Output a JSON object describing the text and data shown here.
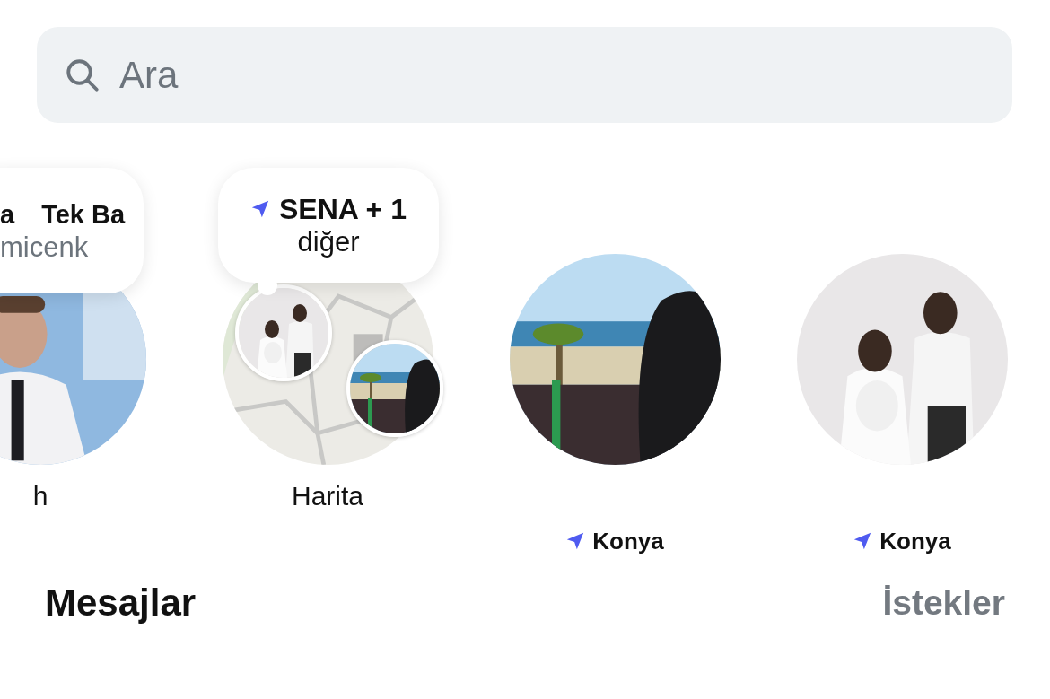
{
  "search": {
    "placeholder": "Ara"
  },
  "stories": [
    {
      "kind": "note",
      "note": {
        "title_parts": [
          "a",
          "Tek Ba"
        ],
        "subtitle": "micenk"
      },
      "label": "h"
    },
    {
      "kind": "map",
      "note": {
        "title_parts": [
          "SENA + 1"
        ],
        "subtitle": "diğer"
      },
      "label": "Harita"
    },
    {
      "kind": "friend",
      "location": "Konya"
    },
    {
      "kind": "friend",
      "location": "Konya"
    }
  ],
  "section": {
    "title": "Mesajlar",
    "link": "İstekler"
  }
}
